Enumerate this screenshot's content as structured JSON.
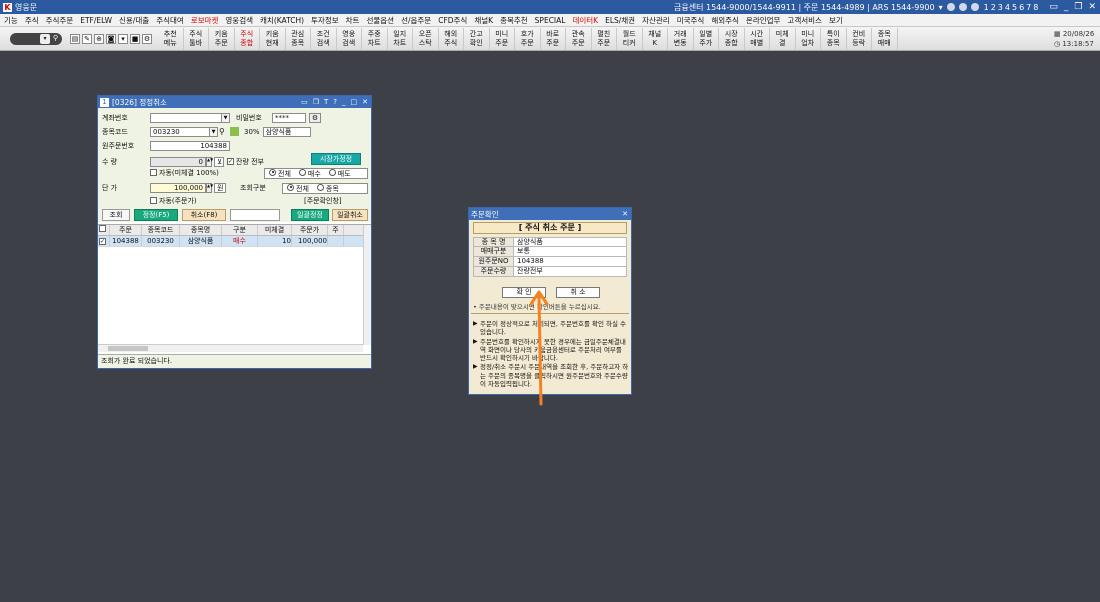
{
  "app": {
    "title": "영웅문",
    "header_info": "금융센터 1544-9000/1544-9911 | 주문 1544-4989 | ARS 1544-9900",
    "pages": [
      "1",
      "2",
      "3",
      "4",
      "5",
      "6",
      "7",
      "8"
    ]
  },
  "menu": [
    "기능",
    "주식",
    "주식주문",
    "ETF/ELW",
    "신용/대출",
    "주식대여",
    "로보마켓",
    "영웅검색",
    "캐치(KATCH)",
    "투자정보",
    "차트",
    "선물옵션",
    "선/옵주문",
    "CFD주식",
    "채널K",
    "종목추천",
    "SPECIAL",
    "데이터K",
    "ELS/채권",
    "자산관리",
    "미국주식",
    "해외주식",
    "온라인업무",
    "고객서비스",
    "보기"
  ],
  "menu_red": [
    "로보마켓",
    "데이터K"
  ],
  "toolbar": {
    "buttons": [
      "추천\n메뉴",
      "주식\n툴바",
      "키움\n주문",
      "주식\n종합",
      "키움\n현재",
      "관심\n종목",
      "조건\n검색",
      "영웅\n검색",
      "주중\n차트",
      "일지\n차트",
      "오픈\n스탁",
      "해외\n주식",
      "간고\n확인",
      "미니\n주문",
      "호가\n주문",
      "바로\n주문",
      "관속\n주문",
      "펼친\n주문",
      "월드\n티커",
      "채널\nK",
      "거래\n변동",
      "일별\n주가",
      "시장\n종합",
      "시간\n매별",
      "미체\n결",
      "미니\n업차",
      "특이\n종목",
      "컨비\n등락",
      "종목\n매매"
    ],
    "red_index": 3,
    "date": "20/08/26",
    "time": "13:18:57"
  },
  "order_window": {
    "title": "[0326] 정정취소",
    "account_label": "계좌번호",
    "password_label": "비밀번호",
    "password_value": "****",
    "stock_code_label": "종목코드",
    "stock_code": "003230",
    "stock_pct": "30%",
    "stock_name": "삼양식품",
    "orig_order_label": "원주문번호",
    "orig_order_no": "104388",
    "market_price_btn": "시장가정정",
    "qty_label": "수  량",
    "qty_value": "0",
    "remain_label": "잔량 전부",
    "auto_unfilled": "자동(미체결 100%)",
    "radio_all": "전체",
    "radio_buy": "매수",
    "radio_sell": "매도",
    "price_label": "단  가",
    "price_value": "100,000",
    "won": "원",
    "lookup_type_label": "조회구분",
    "radio_all2": "전체",
    "radio_stock": "종목",
    "auto_order_price": "자동(주문가)",
    "confirm_link": "[주문확인창]",
    "btn_lookup": "조회",
    "btn_modify": "정정(F5)",
    "btn_cancel": "취소(F8)",
    "btn_bulk_modify": "일괄정정",
    "btn_bulk_cancel": "일괄취소",
    "grid_headers": [
      "주문",
      "종목코드",
      "종목명",
      "구분",
      "미체결",
      "주문가",
      "주"
    ],
    "grid_rows": [
      [
        "104388",
        "003230",
        "삼양식품",
        "매수",
        "10",
        "100,000",
        ""
      ]
    ],
    "status": "조회가 완료 되었습니다."
  },
  "confirm_dialog": {
    "title": "주문확인",
    "header": "[ 주식 취소 주문 ]",
    "rows": [
      {
        "k": "종 목 명",
        "v": "삼양식품"
      },
      {
        "k": "매매구분",
        "v": "보통"
      },
      {
        "k": "원주문NO",
        "v": "104388"
      },
      {
        "k": "주문수량",
        "v": "잔량전부"
      }
    ],
    "confirm_btn": "확  인",
    "cancel_btn": "취  소",
    "note": "• 주문내용이 맞으시면 확인버튼을 누르십시요.",
    "messages": [
      "주문이 정상적으로 처리되면, 주문번호를 확인 하실 수 있습니다.",
      "주문번호를 확인하시지 못한 경우에는 금일주문체결내역 화면이나 당사의 키움금융센터로 주문처리 여부를 반드시 확인하시기 바랍니다.",
      "정정/취소 주문시 주문내역을 조회한 후, 주문하고자 하는 주문의 종목명을 클릭하시면 원주문번호와 주문수량이 자동입력됩니다."
    ]
  },
  "colors": {
    "accent_arrow": "#f58220",
    "title_blue": "#2c5aa0",
    "teal_button": "#18a7a4"
  }
}
